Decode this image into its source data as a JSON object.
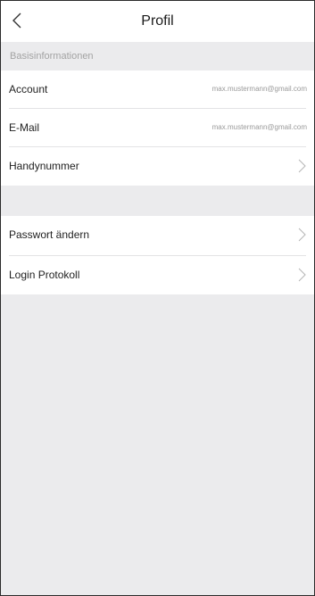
{
  "header": {
    "title": "Profil",
    "back_icon": "chevron-left-icon"
  },
  "basis": {
    "caption": "Basisinformationen",
    "rows": [
      {
        "label": "Account",
        "value": "max.mustermann@gmail.com"
      },
      {
        "label": "E-Mail",
        "value": "max.mustermann@gmail.com"
      },
      {
        "label": "Handynummer",
        "icon": "chevron-right-icon"
      }
    ]
  },
  "security": {
    "rows": [
      {
        "label": "Passwort ändern",
        "icon": "chevron-right-icon"
      },
      {
        "label": "Login Protokoll",
        "icon": "chevron-right-icon"
      }
    ]
  },
  "colors": {
    "background": "#ebebed",
    "card": "#ffffff",
    "caption_text": "#a3a3a3",
    "value_text": "#9a9a9a"
  }
}
